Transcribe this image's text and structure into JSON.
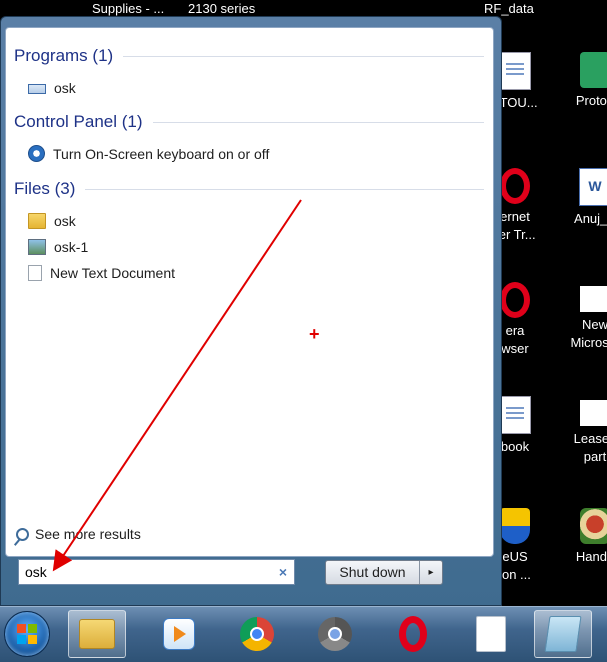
{
  "desktop": {
    "top_labels": [
      "Supplies - ...",
      "2130 series",
      "RF_data"
    ],
    "icons": [
      {
        "label": "_TOU...",
        "kind": "doc"
      },
      {
        "label": "Proton",
        "kind": "proton"
      },
      {
        "label": "ernet\nrer Tr...",
        "kind": "opera"
      },
      {
        "label": "Anuj_A",
        "kind": "word"
      },
      {
        "label": "era\nwser",
        "kind": "opera"
      },
      {
        "label": "New\nMicrosof",
        "kind": "blank"
      },
      {
        "label": "book",
        "kind": "doc"
      },
      {
        "label": "Leased\npart",
        "kind": "blank"
      },
      {
        "label": "eUS\nion ...",
        "kind": "shield"
      },
      {
        "label": "Handb",
        "kind": "handb"
      }
    ]
  },
  "start_menu": {
    "groups": [
      {
        "header": "Programs (1)",
        "items": [
          {
            "label": "osk",
            "icon": "keyboard-icon"
          }
        ]
      },
      {
        "header": "Control Panel (1)",
        "items": [
          {
            "label": "Turn On-Screen keyboard on or off",
            "icon": "ease-of-access-icon"
          }
        ]
      },
      {
        "header": "Files (3)",
        "items": [
          {
            "label": "osk",
            "icon": "folder-icon"
          },
          {
            "label": "osk-1",
            "icon": "image-file-icon"
          },
          {
            "label": "New Text Document",
            "icon": "text-file-icon"
          }
        ]
      }
    ],
    "see_more": "See more results",
    "search": {
      "value": "osk",
      "clear": "×"
    },
    "shutdown": {
      "label": "Shut down",
      "arrow": "▸"
    }
  },
  "annotation": {
    "color": "#e00000",
    "marker": "+"
  }
}
